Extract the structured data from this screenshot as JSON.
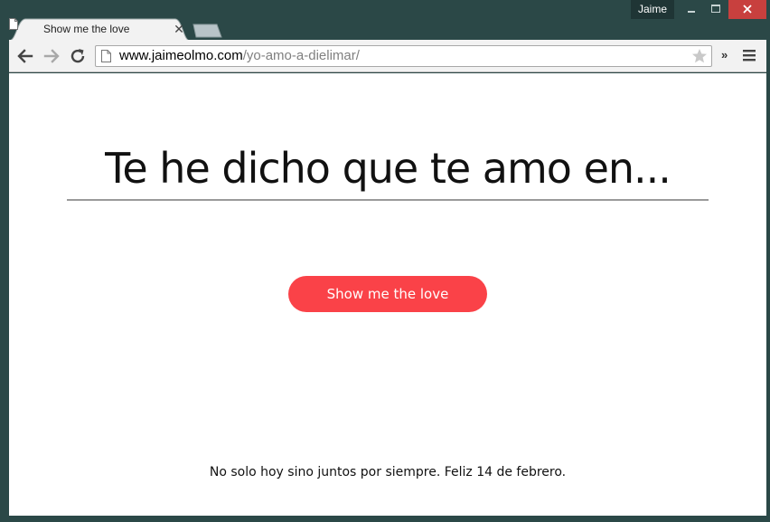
{
  "window": {
    "profile_name": "Jaime",
    "minimize_label": "minimize",
    "maximize_label": "maximize",
    "close_label": "close"
  },
  "tab": {
    "title": "Show me the love",
    "close_glyph": "✕"
  },
  "toolbar": {
    "url_host": "www.jaimeolmo.com",
    "url_path": "/yo-amo-a-dielimar/",
    "extensions_glyph": "»"
  },
  "page": {
    "headline": "Te he dicho que te amo en...",
    "button_label": "Show me the love",
    "footer": "No solo hoy sino juntos por siempre. Feliz 14 de febrero."
  },
  "colors": {
    "accent_button": "#fa4248",
    "window_frame": "#2b4847",
    "close_button": "#c8403e"
  },
  "icons": [
    "page-icon",
    "back-arrow-icon",
    "forward-arrow-icon",
    "reload-icon",
    "star-icon",
    "menu-icon",
    "close-icon"
  ]
}
